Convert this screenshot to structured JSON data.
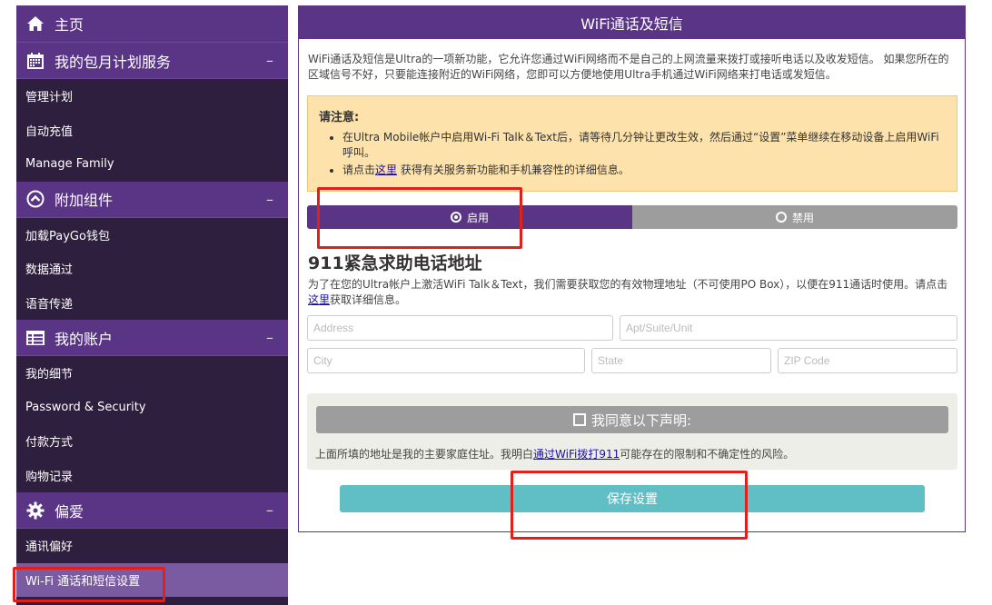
{
  "sidebar": {
    "home_label": "主页",
    "sections": [
      {
        "title": "我的包月计划服务",
        "items": [
          "管理计划",
          "自动充值",
          "Manage Family"
        ]
      },
      {
        "title": "附加组件",
        "items": [
          "加载PayGo钱包",
          "数据通过",
          "语音传递"
        ]
      },
      {
        "title": "我的账户",
        "items": [
          "我的细节",
          "Password & Security",
          "付款方式",
          "购物记录"
        ]
      },
      {
        "title": "偏爱",
        "items": [
          "通讯偏好",
          "Wi-Fi 通话和短信设置"
        ]
      }
    ],
    "collapse_symbol": "–",
    "active_item": "Wi-Fi 通话和短信设置"
  },
  "panel": {
    "title": "WiFi通话及短信",
    "intro": "WiFi通话及短信是Ultra的一项新功能，它允许您通过WiFi网络而不是自己的上网流量来拨打或接听电话以及收发短信。 如果您所在的区域信号不好，只要能连接附近的WiFi网络，您即可以方便地使用Ultra手机通过WiFi网络来打电话或发短信。",
    "notice": {
      "title": "请注意:",
      "item1": "在Ultra Mobile帐户中启用Wi-Fi Talk＆Text后，请等待几分钟让更改生效，然后通过“设置”菜单继续在移动设备上启用WiFi呼叫。",
      "item2_pre": "请点击",
      "item2_link": "这里",
      "item2_post": " 获得有关服务新功能和手机兼容性的详细信息。"
    },
    "toggle": {
      "on_label": "启用",
      "off_label": "禁用",
      "selected": "启用"
    },
    "address": {
      "title": "911紧急求助电话地址",
      "desc_pre": "为了在您的Ultra帐户上激活WiFi Talk＆Text，我们需要获取您的有效物理地址（不可使用PO Box），以便在911通话时使用。请点击",
      "desc_link": "这里",
      "desc_post": "获取详细信息。",
      "placeholders": {
        "address": "Address",
        "apt": "Apt/Suite/Unit",
        "city": "City",
        "state": "State",
        "zip": "ZIP Code"
      }
    },
    "agree": {
      "button_label": "我同意以下声明:",
      "text_pre": "上面所填的地址是我的主要家庭住址。我明白",
      "text_link": "通过WiFi拨打911",
      "text_post": "可能存在的限制和不确定性的风险。"
    },
    "save_label": "保存设置"
  },
  "colors": {
    "brand_purple": "#5a3585",
    "sidebar_bg": "#2d1f3d",
    "notice_bg": "#fde2ac",
    "save_teal": "#5fbfc4",
    "annotation_red": "#e0211b"
  }
}
